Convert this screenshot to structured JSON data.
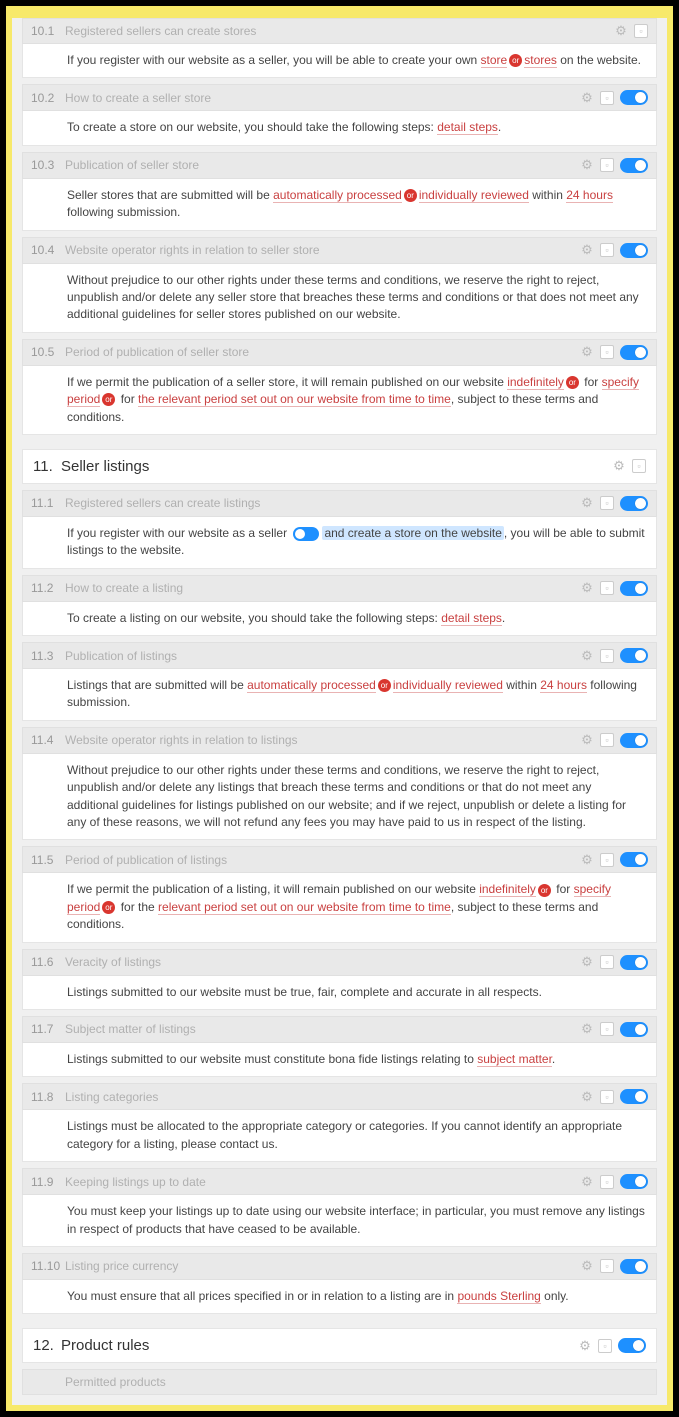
{
  "sections": [
    {
      "num": "11.",
      "title": "Seller listings",
      "hasToggle": false
    },
    {
      "num": "12.",
      "title": "Product rules",
      "hasToggle": true
    }
  ],
  "clauses": [
    {
      "num": "10.1",
      "title": "Registered sellers can create stores",
      "hasToggle": false,
      "body": [
        {
          "t": "text",
          "v": "If you register with our website as a seller, you will be able to create your own "
        },
        {
          "t": "red",
          "v": "store"
        },
        {
          "t": "chip",
          "v": "or"
        },
        {
          "t": "red",
          "v": "stores"
        },
        {
          "t": "text",
          "v": " on the website."
        }
      ]
    },
    {
      "num": "10.2",
      "title": "How to create a seller store",
      "hasToggle": true,
      "body": [
        {
          "t": "text",
          "v": "To create a store on our website, you should take the following steps: "
        },
        {
          "t": "red",
          "v": "detail steps"
        },
        {
          "t": "text",
          "v": "."
        }
      ]
    },
    {
      "num": "10.3",
      "title": "Publication of seller store",
      "hasToggle": true,
      "body": [
        {
          "t": "text",
          "v": "Seller stores that are submitted will be "
        },
        {
          "t": "red",
          "v": "automatically processed"
        },
        {
          "t": "chip",
          "v": "or"
        },
        {
          "t": "red",
          "v": "individually reviewed"
        },
        {
          "t": "text",
          "v": " within "
        },
        {
          "t": "red",
          "v": "24 hours"
        },
        {
          "t": "text",
          "v": " following submission."
        }
      ]
    },
    {
      "num": "10.4",
      "title": "Website operator rights in relation to seller store",
      "hasToggle": true,
      "body": [
        {
          "t": "text",
          "v": "Without prejudice to our other rights under these terms and conditions, we reserve the right to reject, unpublish and/or delete any seller store that breaches these terms and conditions or that does not meet any additional guidelines for seller stores published on our website."
        }
      ]
    },
    {
      "num": "10.5",
      "title": "Period of publication of seller store",
      "hasToggle": true,
      "body": [
        {
          "t": "text",
          "v": "If we permit the publication of a seller store, it will remain published on our website "
        },
        {
          "t": "red",
          "v": "indefinitely"
        },
        {
          "t": "chip",
          "v": "or"
        },
        {
          "t": "text",
          "v": " for "
        },
        {
          "t": "red",
          "v": "specify period"
        },
        {
          "t": "chip",
          "v": "or"
        },
        {
          "t": "text",
          "v": " for "
        },
        {
          "t": "red",
          "v": "the relevant period set out on our website from time to time"
        },
        {
          "t": "text",
          "v": ", subject to these terms and conditions."
        }
      ]
    },
    {
      "num": "11.1",
      "title": "Registered sellers can create listings",
      "hasToggle": true,
      "body": [
        {
          "t": "text",
          "v": "If you register with our website as a seller "
        },
        {
          "t": "chipblue",
          "v": ""
        },
        {
          "t": "blue",
          "v": "and create a store on the website"
        },
        {
          "t": "text",
          "v": ", you will be able to submit listings to the website."
        }
      ]
    },
    {
      "num": "11.2",
      "title": "How to create a listing",
      "hasToggle": true,
      "body": [
        {
          "t": "text",
          "v": "To create a listing on our website, you should take the following steps: "
        },
        {
          "t": "red",
          "v": "detail steps"
        },
        {
          "t": "text",
          "v": "."
        }
      ]
    },
    {
      "num": "11.3",
      "title": "Publication of listings",
      "hasToggle": true,
      "body": [
        {
          "t": "text",
          "v": "Listings that are submitted will be "
        },
        {
          "t": "red",
          "v": "automatically processed"
        },
        {
          "t": "chip",
          "v": "or"
        },
        {
          "t": "red",
          "v": "individually reviewed"
        },
        {
          "t": "text",
          "v": " within "
        },
        {
          "t": "red",
          "v": "24 hours"
        },
        {
          "t": "text",
          "v": " following submission."
        }
      ]
    },
    {
      "num": "11.4",
      "title": "Website operator rights in relation to listings",
      "hasToggle": true,
      "body": [
        {
          "t": "text",
          "v": "Without prejudice to our other rights under these terms and conditions, we reserve the right to reject, unpublish and/or delete any listings that breach these terms and conditions or that do not meet any additional guidelines for listings published on our website; and if we reject, unpublish or delete a listing for any of these reasons, we will not refund any fees you may have paid to us in respect of the listing."
        }
      ]
    },
    {
      "num": "11.5",
      "title": "Period of publication of listings",
      "hasToggle": true,
      "body": [
        {
          "t": "text",
          "v": "If we permit the publication of a listing, it will remain published on our website "
        },
        {
          "t": "red",
          "v": "indefinitely"
        },
        {
          "t": "chip",
          "v": "or"
        },
        {
          "t": "text",
          "v": " for "
        },
        {
          "t": "red",
          "v": "specify period"
        },
        {
          "t": "chip",
          "v": "or"
        },
        {
          "t": "text",
          "v": " for the "
        },
        {
          "t": "red",
          "v": "relevant period set out on our website from time to time"
        },
        {
          "t": "text",
          "v": ", subject to these terms and conditions."
        }
      ]
    },
    {
      "num": "11.6",
      "title": "Veracity of listings",
      "hasToggle": true,
      "body": [
        {
          "t": "text",
          "v": "Listings submitted to our website must be true, fair, complete and accurate in all respects."
        }
      ]
    },
    {
      "num": "11.7",
      "title": "Subject matter of listings",
      "hasToggle": true,
      "body": [
        {
          "t": "text",
          "v": "Listings submitted to our website must constitute bona fide listings relating to "
        },
        {
          "t": "red",
          "v": "subject matter"
        },
        {
          "t": "text",
          "v": "."
        }
      ]
    },
    {
      "num": "11.8",
      "title": "Listing categories",
      "hasToggle": true,
      "body": [
        {
          "t": "text",
          "v": "Listings must be allocated to the appropriate category or categories. If you cannot identify an appropriate category for a listing, please contact us."
        }
      ]
    },
    {
      "num": "11.9",
      "title": "Keeping listings up to date",
      "hasToggle": true,
      "body": [
        {
          "t": "text",
          "v": "You must keep your listings up to date using our website interface; in particular, you must remove any listings in respect of products that have ceased to be available."
        }
      ]
    },
    {
      "num": "11.10",
      "title": "Listing price currency",
      "hasToggle": true,
      "body": [
        {
          "t": "text",
          "v": "You must ensure that all prices specified in or in relation to a listing are in "
        },
        {
          "t": "red",
          "v": "pounds Sterling"
        },
        {
          "t": "text",
          "v": " only."
        }
      ]
    }
  ],
  "trailing_clause_title": "Permitted products"
}
